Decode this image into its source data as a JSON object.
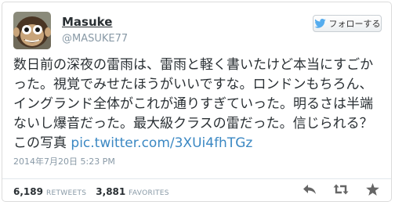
{
  "user": {
    "display_name": "Masuke",
    "handle": "@MASUKE77"
  },
  "follow_button": {
    "label": "フォローする",
    "icon": "twitter-bird-icon"
  },
  "tweet": {
    "text": "数日前の深夜の雷雨は、雷雨と軽く書いたけど本当にすごかった。視覚でみせたほうがいいですな。ロンドンもちろん、イングランド全体がこれが通りすぎていった。明るさは半端ないし爆音だった。最大級クラスの雷だった。信じられる？この写真",
    "link": "pic.twitter.com/3XUi4fhTGz",
    "timestamp": "2014年7月20日 5:23 PM"
  },
  "stats": {
    "retweets_count": "6,189",
    "retweets_label": "RETWEETS",
    "favorites_count": "3,881",
    "favorites_label": "FAVORITES"
  },
  "actions": {
    "reply_icon": "reply-icon",
    "retweet_icon": "retweet-icon",
    "favorite_icon": "star-icon"
  },
  "colors": {
    "link": "#3b88c3",
    "text": "#292f33",
    "muted": "#8899a6",
    "icon": "#666666"
  }
}
